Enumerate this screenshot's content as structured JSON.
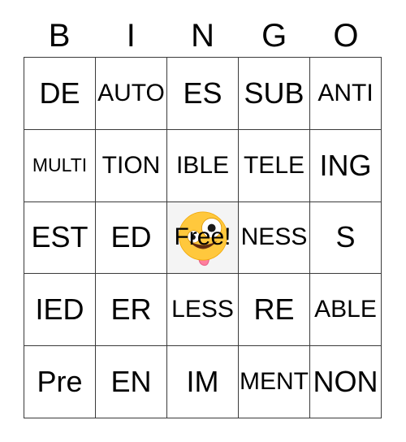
{
  "card": {
    "header": {
      "letters": [
        "B",
        "I",
        "N",
        "G",
        "O"
      ]
    },
    "rows": [
      {
        "cells": [
          {
            "text": "DE",
            "free": false
          },
          {
            "text": "AUTO",
            "free": false
          },
          {
            "text": "ES",
            "free": false
          },
          {
            "text": "SUB",
            "free": false
          },
          {
            "text": "ANTI",
            "free": false
          }
        ]
      },
      {
        "cells": [
          {
            "text": "MULTI",
            "free": false
          },
          {
            "text": "TION",
            "free": false
          },
          {
            "text": "IBLE",
            "free": false
          },
          {
            "text": "TELE",
            "free": false
          },
          {
            "text": "ING",
            "free": false
          }
        ]
      },
      {
        "cells": [
          {
            "text": "EST",
            "free": false
          },
          {
            "text": "ED",
            "free": false
          },
          {
            "text": "Free!",
            "free": true,
            "icon": "zany-face-emoji"
          },
          {
            "text": "NESS",
            "free": false
          },
          {
            "text": "S",
            "free": false
          }
        ]
      },
      {
        "cells": [
          {
            "text": "IED",
            "free": false
          },
          {
            "text": "ER",
            "free": false
          },
          {
            "text": "LESS",
            "free": false
          },
          {
            "text": "RE",
            "free": false
          },
          {
            "text": "ABLE",
            "free": false
          }
        ]
      },
      {
        "cells": [
          {
            "text": "Pre",
            "free": false
          },
          {
            "text": "EN",
            "free": false
          },
          {
            "text": "IM",
            "free": false
          },
          {
            "text": "MENT",
            "free": false
          },
          {
            "text": "NON",
            "free": false
          }
        ]
      }
    ],
    "colors": {
      "background": "#ffffff",
      "border": "#3a3a3a",
      "text": "#000000",
      "free_space_background": "#f4f4f4",
      "emoji_face": "#ffc83d",
      "emoji_tongue": "#ff7f9e"
    }
  }
}
